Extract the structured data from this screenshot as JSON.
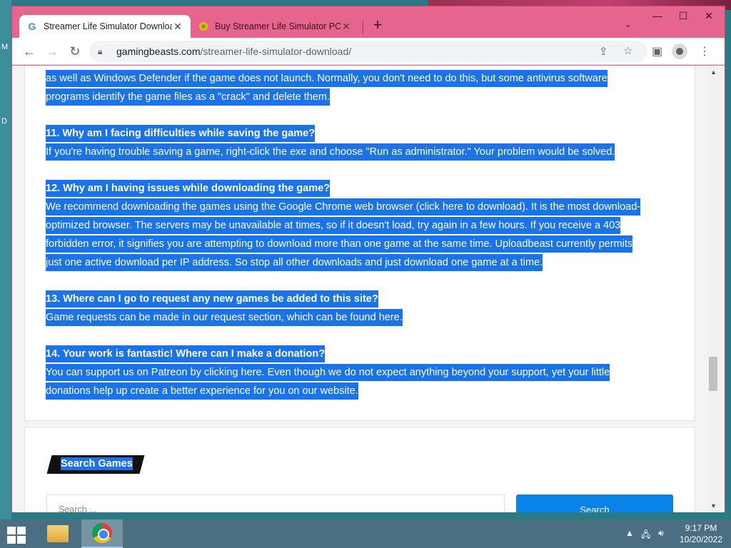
{
  "desktop": {
    "left_chars": [
      "M",
      "D"
    ]
  },
  "browser": {
    "tabs": [
      {
        "title": "Streamer Life Simulator Downloa",
        "active": true,
        "favicon": "G"
      },
      {
        "title": "Buy Streamer Life Simulator PC S",
        "active": false
      }
    ],
    "address": {
      "host": "gamingbeasts.com",
      "path": "/streamer-life-simulator-download/"
    }
  },
  "article": {
    "lines": [
      {
        "text": "as well as Windows Defender if the game does not launch. Normally, you don't need to do this, but some antivirus software",
        "bold": false
      },
      {
        "text": "programs identify the game files as a \"crack\" and delete them.",
        "bold": false
      },
      {
        "text": "11. Why am I facing difficulties while saving the game?",
        "bold": true
      },
      {
        "text": "If you're having trouble saving a game, right-click the exe and choose \"Run as administrator.\" Your problem would be solved.",
        "bold": false
      },
      {
        "text": "12. Why am I having issues while downloading the game?",
        "bold": true
      },
      {
        "text": "We recommend downloading the games using the Google Chrome web browser (click here to download). It is the most download-",
        "bold": false
      },
      {
        "text": "optimized browser. The servers may be unavailable at times, so if it doesn't load, try again in a few hours. If you receive a 403",
        "bold": false
      },
      {
        "text": "forbidden error, it signifies you are attempting to download more than one game at the same time. Uploadbeast currently permits",
        "bold": false
      },
      {
        "text": "just one active download per IP address. So stop all other downloads and just download one game at a time.",
        "bold": false
      },
      {
        "text": "13. Where can I go to request any new games be added to this site?",
        "bold": true
      },
      {
        "text": "Game requests can be made in our request section, which can be found here.",
        "bold": false
      },
      {
        "text": "14. Your work is fantastic! Where can I make a donation?",
        "bold": true
      },
      {
        "text": "You can support us on Patreon by clicking here. Even though we do not expect anything beyond your support, yet your little",
        "bold": false
      },
      {
        "text": "donations help up create a better experience for you on our website.",
        "bold": false
      }
    ]
  },
  "sidebar_widget": {
    "title": "Search Games",
    "search_placeholder": "Search ...",
    "search_button": "Search"
  },
  "taskbar": {
    "time": "9:17 PM",
    "date": "10/20/2022"
  },
  "colors": {
    "selection": "#1a73e8",
    "tab_strip": "#e5658e",
    "search_button": "#0a84e8"
  }
}
